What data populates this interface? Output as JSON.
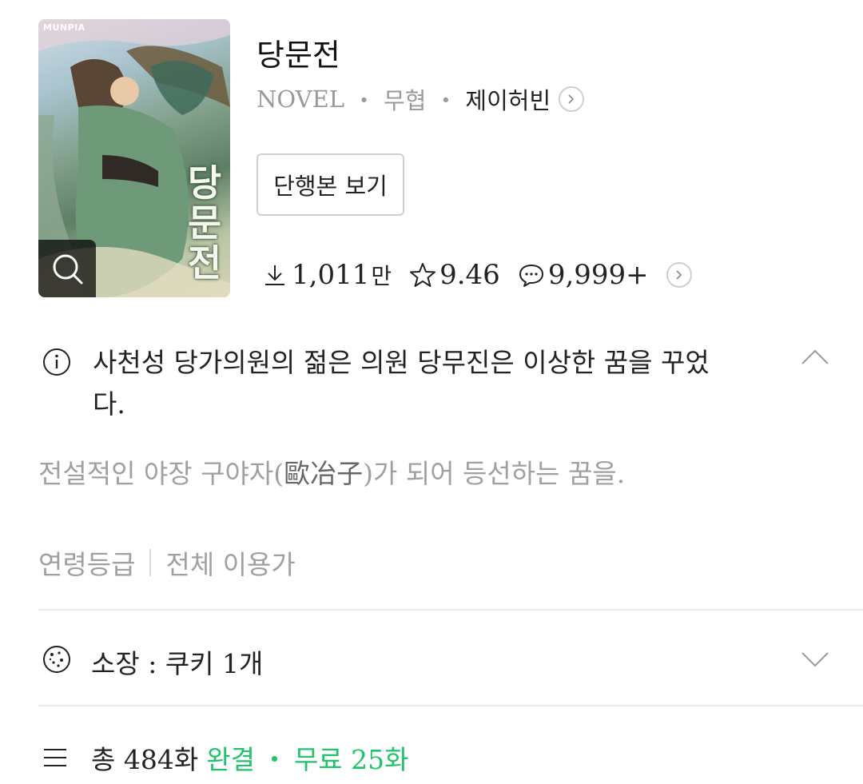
{
  "cover": {
    "brand": "MUNPIA",
    "title_art": "당문전"
  },
  "book": {
    "title": "당문전",
    "format": "NOVEL",
    "separator": "・",
    "genre": "무협",
    "author": "제이허빈"
  },
  "actions": {
    "single_volume_label": "단행본 보기"
  },
  "stats": {
    "views": "1,011",
    "views_unit": "만",
    "rating": "9.46",
    "comments": "9,999+"
  },
  "summary": {
    "text": "사천성 당가의원의 젊은 의원 당무진은 이상한 꿈을 꾸었다."
  },
  "description": {
    "before": "전설적인 야장 구야자(",
    "hanja": "歐冶子",
    "after": ")가 되어 등선하는 꿈을."
  },
  "rating_info": {
    "label": "연령등급",
    "value": "전체 이용가"
  },
  "owned": {
    "label": "소장 : 쿠키 1개"
  },
  "episodes": {
    "total": "총 484화",
    "status": "완결",
    "separator": "・",
    "free": "무료 25화"
  },
  "colors": {
    "accent_green": "#20c369",
    "muted_text": "#a0a0a0",
    "divider": "#e8e8e8"
  }
}
